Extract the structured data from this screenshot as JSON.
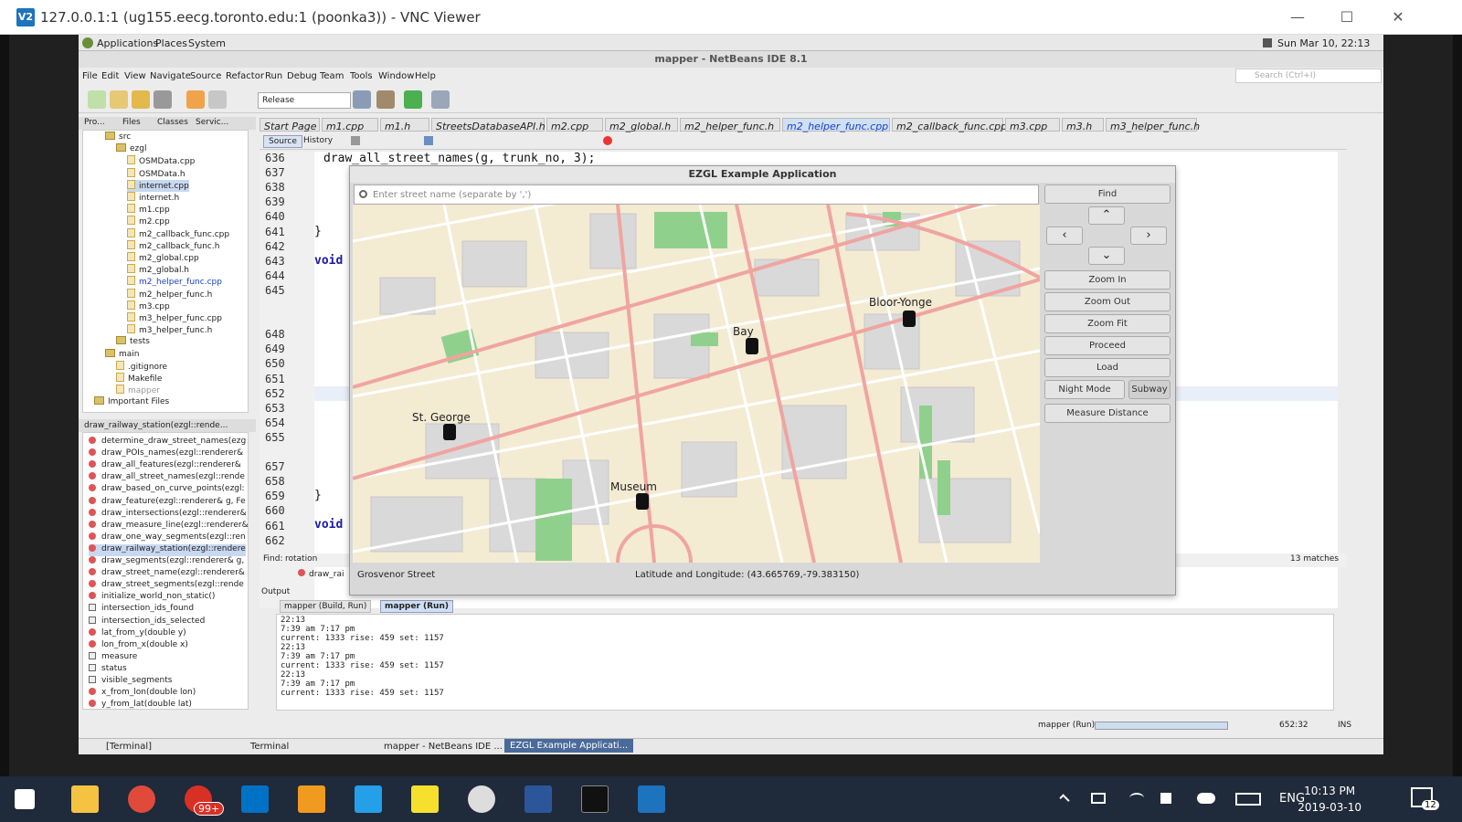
{
  "vnc": {
    "title": "127.0.0.1:1 (ug155.eecg.toronto.edu:1 (poonka3)) - VNC Viewer",
    "logo": "V2"
  },
  "gnome_panel": {
    "applications": "Applications",
    "places": "Places",
    "system": "System",
    "clock": "Sun Mar 10, 22:13"
  },
  "netbeans": {
    "title": "mapper - NetBeans IDE 8.1",
    "menu": [
      "File",
      "Edit",
      "View",
      "Navigate",
      "Source",
      "Refactor",
      "Run",
      "Debug",
      "Team",
      "Tools",
      "Window",
      "Help"
    ],
    "search_placeholder": "Search (Ctrl+I)",
    "config": "Release",
    "proj_tabs": [
      "Pro...",
      "Files",
      "Classes",
      "Servic..."
    ],
    "tree": [
      {
        "label": "src",
        "type": "folder",
        "indent": 2
      },
      {
        "label": "ezgl",
        "type": "folder",
        "indent": 3
      },
      {
        "label": "OSMData.cpp",
        "type": "file",
        "indent": 4
      },
      {
        "label": "OSMData.h",
        "type": "file",
        "indent": 4
      },
      {
        "label": "internet.cpp",
        "type": "file",
        "indent": 4,
        "selected": true
      },
      {
        "label": "internet.h",
        "type": "file",
        "indent": 4
      },
      {
        "label": "m1.cpp",
        "type": "file",
        "indent": 4
      },
      {
        "label": "m2.cpp",
        "type": "file",
        "indent": 4
      },
      {
        "label": "m2_callback_func.cpp",
        "type": "file",
        "indent": 4
      },
      {
        "label": "m2_callback_func.h",
        "type": "file",
        "indent": 4
      },
      {
        "label": "m2_global.cpp",
        "type": "file",
        "indent": 4
      },
      {
        "label": "m2_global.h",
        "type": "file",
        "indent": 4
      },
      {
        "label": "m2_helper_func.cpp",
        "type": "file",
        "indent": 4,
        "modified": true
      },
      {
        "label": "m2_helper_func.h",
        "type": "file",
        "indent": 4
      },
      {
        "label": "m3.cpp",
        "type": "file",
        "indent": 4
      },
      {
        "label": "m3_helper_func.cpp",
        "type": "file",
        "indent": 4
      },
      {
        "label": "m3_helper_func.h",
        "type": "file",
        "indent": 4
      },
      {
        "label": "tests",
        "type": "folder",
        "indent": 3
      },
      {
        "label": "main",
        "type": "folder",
        "indent": 2
      },
      {
        "label": ".gitignore",
        "type": "file",
        "indent": 3
      },
      {
        "label": "Makefile",
        "type": "file",
        "indent": 3
      },
      {
        "label": "mapper",
        "type": "file",
        "indent": 3,
        "dim": true
      },
      {
        "label": "Important Files",
        "type": "folder",
        "indent": 1
      }
    ],
    "navigator_title": "draw_railway_station(ezgl::rende...",
    "navigator": [
      {
        "label": "determine_draw_street_names(ezg",
        "kind": "method"
      },
      {
        "label": "draw_POIs_names(ezgl::renderer&",
        "kind": "method"
      },
      {
        "label": "draw_all_features(ezgl::renderer&",
        "kind": "method"
      },
      {
        "label": "draw_all_street_names(ezgl::rende",
        "kind": "method"
      },
      {
        "label": "draw_based_on_curve_points(ezgl:",
        "kind": "method"
      },
      {
        "label": "draw_feature(ezgl::renderer& g, Fe",
        "kind": "method"
      },
      {
        "label": "draw_intersections(ezgl::renderer&",
        "kind": "method"
      },
      {
        "label": "draw_measure_line(ezgl::renderer&",
        "kind": "method"
      },
      {
        "label": "draw_one_way_segments(ezgl::ren",
        "kind": "method"
      },
      {
        "label": "draw_railway_station(ezgl::rendere",
        "kind": "method",
        "selected": true
      },
      {
        "label": "draw_segments(ezgl::renderer& g,",
        "kind": "method"
      },
      {
        "label": "draw_street_name(ezgl::renderer&",
        "kind": "method"
      },
      {
        "label": "draw_street_segments(ezgl::rende",
        "kind": "method"
      },
      {
        "label": "initialize_world_non_static()",
        "kind": "method"
      },
      {
        "label": "intersection_ids_found",
        "kind": "field"
      },
      {
        "label": "intersection_ids_selected",
        "kind": "field"
      },
      {
        "label": "lat_from_y(double y)",
        "kind": "method"
      },
      {
        "label": "lon_from_x(double x)",
        "kind": "method"
      },
      {
        "label": "measure",
        "kind": "field"
      },
      {
        "label": "status",
        "kind": "field"
      },
      {
        "label": "visible_segments",
        "kind": "field"
      },
      {
        "label": "x_from_lon(double lon)",
        "kind": "method"
      },
      {
        "label": "y_from_lat(double lat)",
        "kind": "method"
      }
    ],
    "editor_tabs": [
      "Start Page",
      "m1.cpp",
      "m1.h",
      "StreetsDatabaseAPI.h",
      "m2.cpp",
      "m2_global.h",
      "m2_helper_func.h",
      "m2_helper_func.cpp",
      "m2_callback_func.cpp",
      "m3.cpp",
      "m3.h",
      "m3_helper_func.h"
    ],
    "active_tab": "m2_helper_func.cpp",
    "source_btn": "Source",
    "history_btn": "History",
    "line_numbers": [
      "636",
      "637",
      "638",
      "639",
      "640",
      "641",
      "642",
      "643",
      "644",
      "645",
      "",
      "",
      "648",
      "649",
      "650",
      "651",
      "652",
      "653",
      "654",
      "655",
      "",
      "657",
      "658",
      "659",
      "660",
      "661",
      "662"
    ],
    "code_top": "draw_all_street_names(g, trunk_no, 3);",
    "code_brace1": "}",
    "code_void1": "void",
    "code_brace2": "}",
    "code_void2": "void",
    "find_label": "Find:",
    "find_value": "rotation",
    "matches": "13 matches",
    "breadcrumb": "draw_rai",
    "output_title": "Output",
    "output_tabs": [
      "mapper (Build, Run)",
      "mapper (Run)"
    ],
    "console": "22:13\n7:39 am 7:17 pm\ncurrent: 1333 rise: 459 set: 1157\n22:13\n7:39 am 7:17 pm\ncurrent: 1333 rise: 459 set: 1157\n22:13\n7:39 am 7:17 pm\ncurrent: 1333 rise: 459 set: 1157",
    "status_run": "mapper (Run)",
    "status_pos": "652:32",
    "status_ins": "INS"
  },
  "ezgl": {
    "title": "EZGL Example Application",
    "search_placeholder": "Enter street name (separate by ',')",
    "buttons": {
      "find": "Find",
      "zoom_in": "Zoom In",
      "zoom_out": "Zoom Out",
      "zoom_fit": "Zoom Fit",
      "proceed": "Proceed",
      "load": "Load",
      "night_mode": "Night Mode",
      "subway": "Subway",
      "measure": "Measure Distance"
    },
    "stations": [
      "Bloor-Yonge",
      "Bay",
      "St. George",
      "Museum"
    ],
    "status_street": "Grosvenor Street",
    "status_latlon": "Latitude and Longitude: (43.665769,-79.383150)"
  },
  "remote_taskbar": {
    "items": [
      "[Terminal]",
      "Terminal",
      "mapper - NetBeans IDE ...",
      "EZGL Example Applicati..."
    ]
  },
  "windows_taskbar": {
    "time": "10:13 PM",
    "date": "2019-03-10",
    "lang": "ENG",
    "chrome_badge": "99+",
    "notif_count": "12"
  }
}
